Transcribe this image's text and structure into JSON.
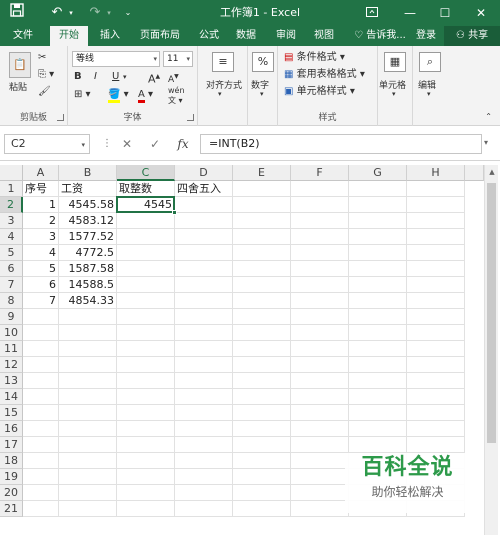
{
  "titlebar": {
    "save_icon": "save-icon",
    "undo_icon": "undo-icon",
    "redo_icon": "redo-icon",
    "title": "工作簿1 - Excel",
    "ribbon_display_icon": "ribbon-display-icon"
  },
  "tabs": [
    {
      "label": "文件",
      "active": false
    },
    {
      "label": "开始",
      "active": true
    },
    {
      "label": "插入",
      "active": false
    },
    {
      "label": "页面布局",
      "active": false
    },
    {
      "label": "公式",
      "active": false
    },
    {
      "label": "数据",
      "active": false
    },
    {
      "label": "审阅",
      "active": false
    },
    {
      "label": "视图",
      "active": false
    }
  ],
  "tellme": "告诉我...",
  "login": "登录",
  "share": "共享",
  "ribbon": {
    "clipboard": {
      "paste": "粘贴",
      "label": "剪贴板"
    },
    "font": {
      "name": "等线",
      "size": "11",
      "bold": "B",
      "italic": "I",
      "underline": "U",
      "grow": "A",
      "shrink": "A",
      "font_color": "A",
      "wen": "wén",
      "label": "字体"
    },
    "alignment": {
      "label": "对齐方式"
    },
    "number": {
      "icon": "%",
      "label": "数字"
    },
    "styles": {
      "conditional": "条件格式",
      "table": "套用表格格式",
      "cell": "单元格样式",
      "label": "样式"
    },
    "cells": {
      "label": "单元格"
    },
    "editing": {
      "label": "编辑"
    }
  },
  "formulabar": {
    "namebox": "C2",
    "cancel": "✕",
    "enter": "✓",
    "fx": "fx",
    "formula": "=INT(B2)"
  },
  "columns": [
    "A",
    "B",
    "C",
    "D",
    "E",
    "F",
    "G",
    "H"
  ],
  "rows": [
    "1",
    "2",
    "3",
    "4",
    "5",
    "6",
    "7",
    "8",
    "9",
    "10",
    "11",
    "12",
    "13",
    "14",
    "15",
    "16",
    "17",
    "18",
    "19",
    "20",
    "21"
  ],
  "cells": {
    "A1": "序号",
    "B1": "工资",
    "C1": "取整数",
    "D1": "四舍五入",
    "A2": "1",
    "B2": "4545.58",
    "C2": "4545",
    "A3": "2",
    "B3": "4583.12",
    "A4": "3",
    "B4": "1577.52",
    "A5": "4",
    "B5": "4772.5",
    "A6": "5",
    "B6": "1587.58",
    "A7": "6",
    "B7": "14588.5",
    "A8": "7",
    "B8": "4854.33"
  },
  "selected_cell": "C2",
  "watermark": {
    "title": "百科全说",
    "subtitle": "助你轻松解决"
  },
  "colors": {
    "excel_green": "#217346"
  }
}
